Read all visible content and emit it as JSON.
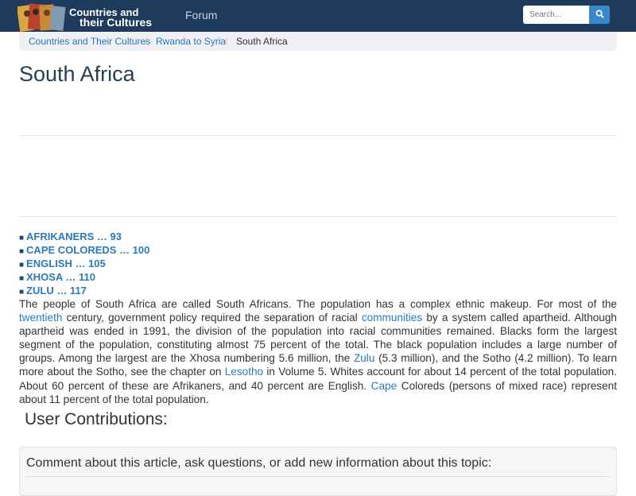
{
  "header": {
    "logo_line1": "Countries and",
    "logo_line2": "their Cultures",
    "nav_forum": "Forum",
    "search_placeholder": "Search..."
  },
  "breadcrumb": [
    "Countries and Their Cultures",
    "Rwanda to Syria",
    "South Africa"
  ],
  "breadcrumb_separator": "/",
  "page_title": "South Africa",
  "toc": [
    "AFRIKANERS … 93",
    "CAPE COLOREDS … 100",
    "ENGLISH … 105",
    "XHOSA … 110",
    "ZULU … 117"
  ],
  "toc_bullet": "■",
  "paragraph": {
    "t1": "The people of South Africa are called South Africans. The population has a complex ethnic makeup. For most of the ",
    "l1": "twentieth",
    "t2": " century, government policy required the separation of racial ",
    "l2": "communities",
    "t3": " by a system called apartheid. Although apartheid was ended in 1991, the division of the population into racial communities remained. Blacks form the largest segment of the population, constituting almost 75 percent of the total. The black population includes a large number of groups. Among the largest are the Xhosa numbering 5.6 million, the ",
    "l3": "Zulu",
    "t4": " (5.3 million), and the Sotho (4.2 million). To learn more about the Sotho, see the chapter on ",
    "l4": "Lesotho",
    "t5": " in Volume 5. Whites account for about 14 percent of the total population. About 60 percent of these are Afrikaners, and 40 percent are English. ",
    "l5": "Cape",
    "t6": " Coloreds (persons of mixed race) represent about 11 percent of the total population."
  },
  "user_contributions_heading": "User Contributions:",
  "comment_prompt": "Comment about this article, ask questions, or add new information about this topic:",
  "colors": {
    "navbar": "#1e3a5c",
    "link": "#2a7ab8",
    "search_button": "#3a87c9"
  }
}
